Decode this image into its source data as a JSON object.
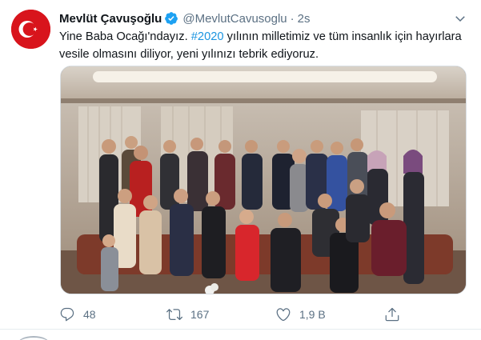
{
  "tweet": {
    "display_name": "Mevlüt Çavuşoğlu",
    "handle": "@MevlutCavusoglu",
    "separator": "·",
    "time": "2s",
    "text_part1": "Yine Baba Ocağı'ndayız. ",
    "hashtag": "#2020",
    "text_part2": " yılının milletimiz ve tüm insanlık için hayırlara vesile olmasını diliyor, yeni yılınızı tebrik ediyoruz."
  },
  "actions": {
    "reply_count": "48",
    "retweet_count": "167",
    "like_count": "1,9 B"
  },
  "icons": {
    "avatar": "turkish-flag",
    "verified": "verified-badge-icon",
    "caret": "chevron-down-icon",
    "reply": "reply-icon",
    "retweet": "retweet-icon",
    "like": "heart-icon",
    "share": "share-icon"
  },
  "colors": {
    "text_primary": "#0f1419",
    "text_secondary": "#5b7083",
    "link": "#1b95e0",
    "verified": "#1da1f2",
    "flag_red": "#d8141c"
  }
}
